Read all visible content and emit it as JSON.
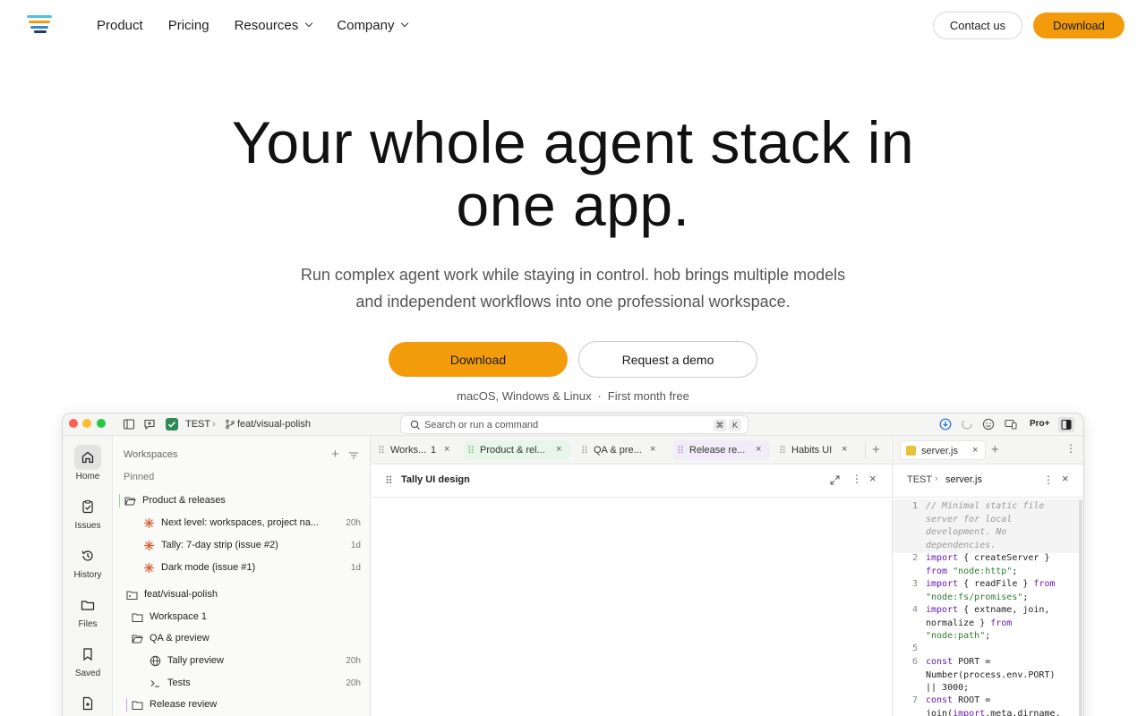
{
  "nav": {
    "links": [
      {
        "label": "Product",
        "dropdown": false
      },
      {
        "label": "Pricing",
        "dropdown": false
      },
      {
        "label": "Resources",
        "dropdown": true
      },
      {
        "label": "Company",
        "dropdown": true
      }
    ],
    "contact_label": "Contact us",
    "download_label": "Download"
  },
  "hero": {
    "title_line1": "Your whole agent stack in",
    "title_line2": "one app.",
    "subtitle_line1": "Run complex agent work while staying in control. hob brings multiple models",
    "subtitle_line2": "and independent workflows into one professional workspace.",
    "download_label": "Download",
    "demo_label": "Request a demo",
    "platforms": "macOS, Windows & Linux",
    "separator": "·",
    "offer": "First month free"
  },
  "app": {
    "titlebar": {
      "project": "TEST",
      "branch": "feat/visual-polish",
      "search_placeholder": "Search or run a command",
      "shortcut_mod": "⌘",
      "shortcut_key": "K",
      "plan_badge": "Pro+"
    },
    "rail": [
      {
        "label": "Home",
        "icon": "home-icon",
        "active": true
      },
      {
        "label": "Issues",
        "icon": "clipboard-icon",
        "active": false
      },
      {
        "label": "History",
        "icon": "history-icon",
        "active": false
      },
      {
        "label": "Files",
        "icon": "folder-icon",
        "active": false
      },
      {
        "label": "Saved",
        "icon": "bookmark-icon",
        "active": false
      }
    ],
    "panel": {
      "heading": "Workspaces",
      "pinned_label": "Pinned",
      "rows": [
        {
          "text": "Product & releases",
          "time": "",
          "icon": "folder-icon"
        },
        {
          "text": "Next level: workspaces, project na...",
          "time": "20h",
          "icon": "agent-icon"
        },
        {
          "text": "Tally: 7-day strip (issue #2)",
          "time": "1d",
          "icon": "agent-icon"
        },
        {
          "text": "Dark mode (issue #1)",
          "time": "1d",
          "icon": "agent-icon"
        },
        {
          "text": "feat/visual-polish",
          "time": "",
          "icon": "branch-folder-icon"
        },
        {
          "text": "Workspace 1",
          "time": "",
          "icon": "folder-icon"
        },
        {
          "text": "QA & preview",
          "time": "",
          "icon": "folder-icon"
        },
        {
          "text": "Tally preview",
          "time": "20h",
          "icon": "globe-icon"
        },
        {
          "text": "Tests",
          "time": "20h",
          "icon": "terminal-icon"
        },
        {
          "text": "Release review",
          "time": "",
          "icon": "folder-icon"
        }
      ]
    },
    "tabs": [
      {
        "label": "Works...",
        "count": "1"
      },
      {
        "label": "Product & rel..."
      },
      {
        "label": "QA & pre..."
      },
      {
        "label": "Release re..."
      },
      {
        "label": "Habits UI"
      }
    ],
    "editor_title": "Tally UI design",
    "code": {
      "tab": "server.js",
      "crumb_root": "TEST",
      "crumb_file": "server.js",
      "line_numbers": [
        "1",
        "2",
        "3",
        "4",
        "5",
        "6",
        "7"
      ]
    },
    "colors": {
      "accent": "#f39c0b",
      "status_green": "#2e8b57",
      "agent_orange": "#e0623b"
    }
  }
}
